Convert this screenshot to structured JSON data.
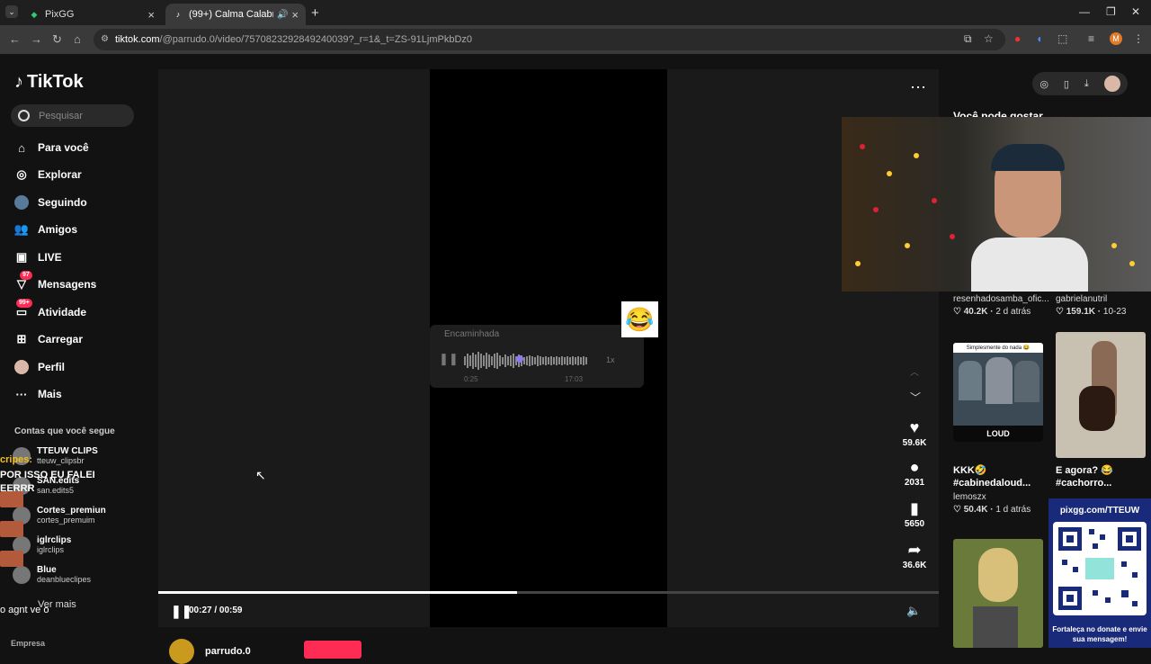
{
  "browser": {
    "tabs": [
      {
        "title": "PixGG",
        "active": false
      },
      {
        "title": "(99+) Calma Calabreso: Men",
        "active": true
      }
    ],
    "url_host": "tiktok.com",
    "url_path": "/@parrudo.0/video/7570823292849240039?_r=1&_t=ZS-91LjmPkbDz0",
    "profile_initial": "M"
  },
  "sidebar": {
    "logo": "TikTok",
    "search_placeholder": "Pesquisar",
    "items": [
      {
        "label": "Para você",
        "icon": "home-icon"
      },
      {
        "label": "Explorar",
        "icon": "compass-icon"
      },
      {
        "label": "Seguindo",
        "icon": "following-avatar-icon"
      },
      {
        "label": "Amigos",
        "icon": "friends-icon"
      },
      {
        "label": "LIVE",
        "icon": "live-icon"
      },
      {
        "label": "Mensagens",
        "icon": "messages-icon",
        "badge": "97"
      },
      {
        "label": "Atividade",
        "icon": "activity-icon",
        "badge": "99+"
      },
      {
        "label": "Carregar",
        "icon": "upload-icon"
      },
      {
        "label": "Perfil",
        "icon": "profile-icon"
      },
      {
        "label": "Mais",
        "icon": "more-icon"
      }
    ],
    "following_header": "Contas que você segue",
    "accounts": [
      {
        "name": "TTEUW CLIPS",
        "handle": "tteuw_clipsbr"
      },
      {
        "name": "SAN.edits",
        "handle": "san.edits5"
      },
      {
        "name": "Cortes_premiun",
        "handle": "cortes_premuim"
      },
      {
        "name": "iglrclips",
        "handle": "iglrclips"
      },
      {
        "name": "Blue",
        "handle": "deanblueclipes"
      }
    ],
    "see_more": "Ver mais",
    "footer": "Empresa"
  },
  "stream_overlay": {
    "chat_partial": "cripes:",
    "chat_line1": "POR ISSO EU FALEI",
    "chat_line2": "EERRR",
    "bottom_text": "o agnt ve o"
  },
  "video": {
    "audio_card": {
      "title": "Encaminhada",
      "speed": "1x",
      "elapsed": "0:25",
      "total": "17:03"
    },
    "emoji": "😂",
    "actions": [
      {
        "icon": "heart-icon",
        "count": "59.6K"
      },
      {
        "icon": "comment-icon",
        "count": "2031"
      },
      {
        "icon": "bookmark-icon",
        "count": "5650"
      },
      {
        "icon": "share-icon",
        "count": "36.6K"
      }
    ],
    "time": "00:27 / 00:59",
    "progress": 0.46,
    "author": "parrudo.0"
  },
  "right": {
    "section_title": "Você pode gostar",
    "cards": [
      {
        "user": "resenhadosamba_ofic...",
        "likes": "40.2K",
        "age": "2 d atrás"
      },
      {
        "user": "gabrielanutril",
        "likes": "159.1K",
        "age": "10-23"
      },
      {
        "caption_line1": "KKK🤣",
        "caption_line2": "#cabinedaloud...",
        "user": "lemoszx",
        "likes": "50.4K",
        "age": "1 d atrás",
        "thumb_text": "Simplesmente do nada 😂",
        "thumb_brand": "LOUD"
      },
      {
        "caption_line1": "E agora? 😂",
        "caption_line2": "#cachorro..."
      }
    ]
  },
  "pix": {
    "url": "pixgg.com/TTEUW",
    "message": "Fortaleça no donate e envie sua mensagem!"
  }
}
